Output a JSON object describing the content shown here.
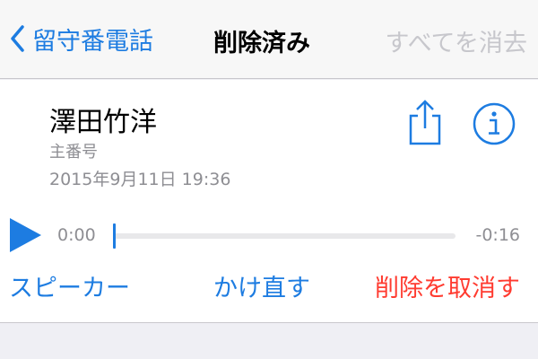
{
  "navbar": {
    "back_label": "留守番電話",
    "title": "削除済み",
    "clear_all_label": "すべてを消去"
  },
  "message": {
    "caller_name": "澤田竹洋",
    "number_label": "主番号",
    "timestamp": "2015年9月11日 19:36"
  },
  "player": {
    "elapsed": "0:00",
    "remaining": "-0:16",
    "progress": 0
  },
  "actions": {
    "speaker_label": "スピーカー",
    "call_back_label": "かけ直す",
    "undelete_label": "削除を取消す"
  },
  "icons": {
    "back": "chevron-left-icon",
    "share": "share-icon",
    "info": "info-icon",
    "play": "play-icon"
  },
  "colors": {
    "accent": "#1d7ce1",
    "destructive": "#ff3b30",
    "disabled": "#c7c7cc",
    "secondary_text": "#8e8e93",
    "navbar_bg": "#f7f7f7",
    "background": "#efeff4"
  }
}
